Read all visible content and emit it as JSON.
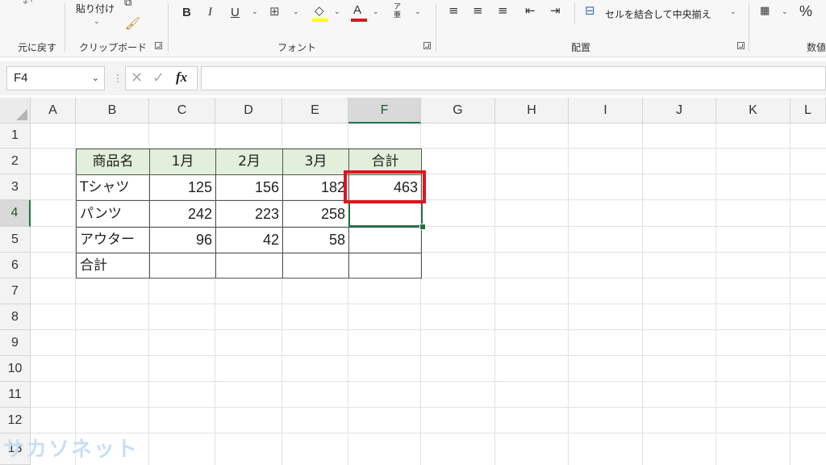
{
  "ribbon": {
    "undo_label": "元に戻す",
    "paste_label": "貼り付け",
    "clipboard_label": "クリップボード",
    "font_label": "フォント",
    "bold": "B",
    "italic": "I",
    "underline": "U",
    "font_color_letter": "A",
    "furigana": "ア亜",
    "alignment_label": "配置",
    "merge_center_label": "セルを結合して中央揃え",
    "number_label": "数値",
    "percent": "%"
  },
  "formula_bar": {
    "name_box": "F4",
    "fx": "fx",
    "formula": ""
  },
  "columns": [
    "A",
    "B",
    "C",
    "D",
    "E",
    "F",
    "G",
    "H",
    "I",
    "J",
    "K",
    "L"
  ],
  "rows": [
    "1",
    "2",
    "3",
    "4",
    "5",
    "6",
    "7",
    "8",
    "9",
    "10",
    "11",
    "12",
    "13"
  ],
  "selected_column": "F",
  "selected_row": "4",
  "table": {
    "header": [
      "商品名",
      "1月",
      "2月",
      "3月",
      "合計"
    ],
    "body": [
      [
        "Tシャツ",
        "125",
        "156",
        "182",
        "463"
      ],
      [
        "パンツ",
        "242",
        "223",
        "258",
        ""
      ],
      [
        "アウター",
        "96",
        "42",
        "58",
        ""
      ],
      [
        "合計",
        "",
        "",
        "",
        ""
      ]
    ]
  },
  "watermark": "サカソネット",
  "colors": {
    "header_fill": "#e2efda",
    "selection_green": "#217346",
    "highlight_red": "#e0141e"
  }
}
